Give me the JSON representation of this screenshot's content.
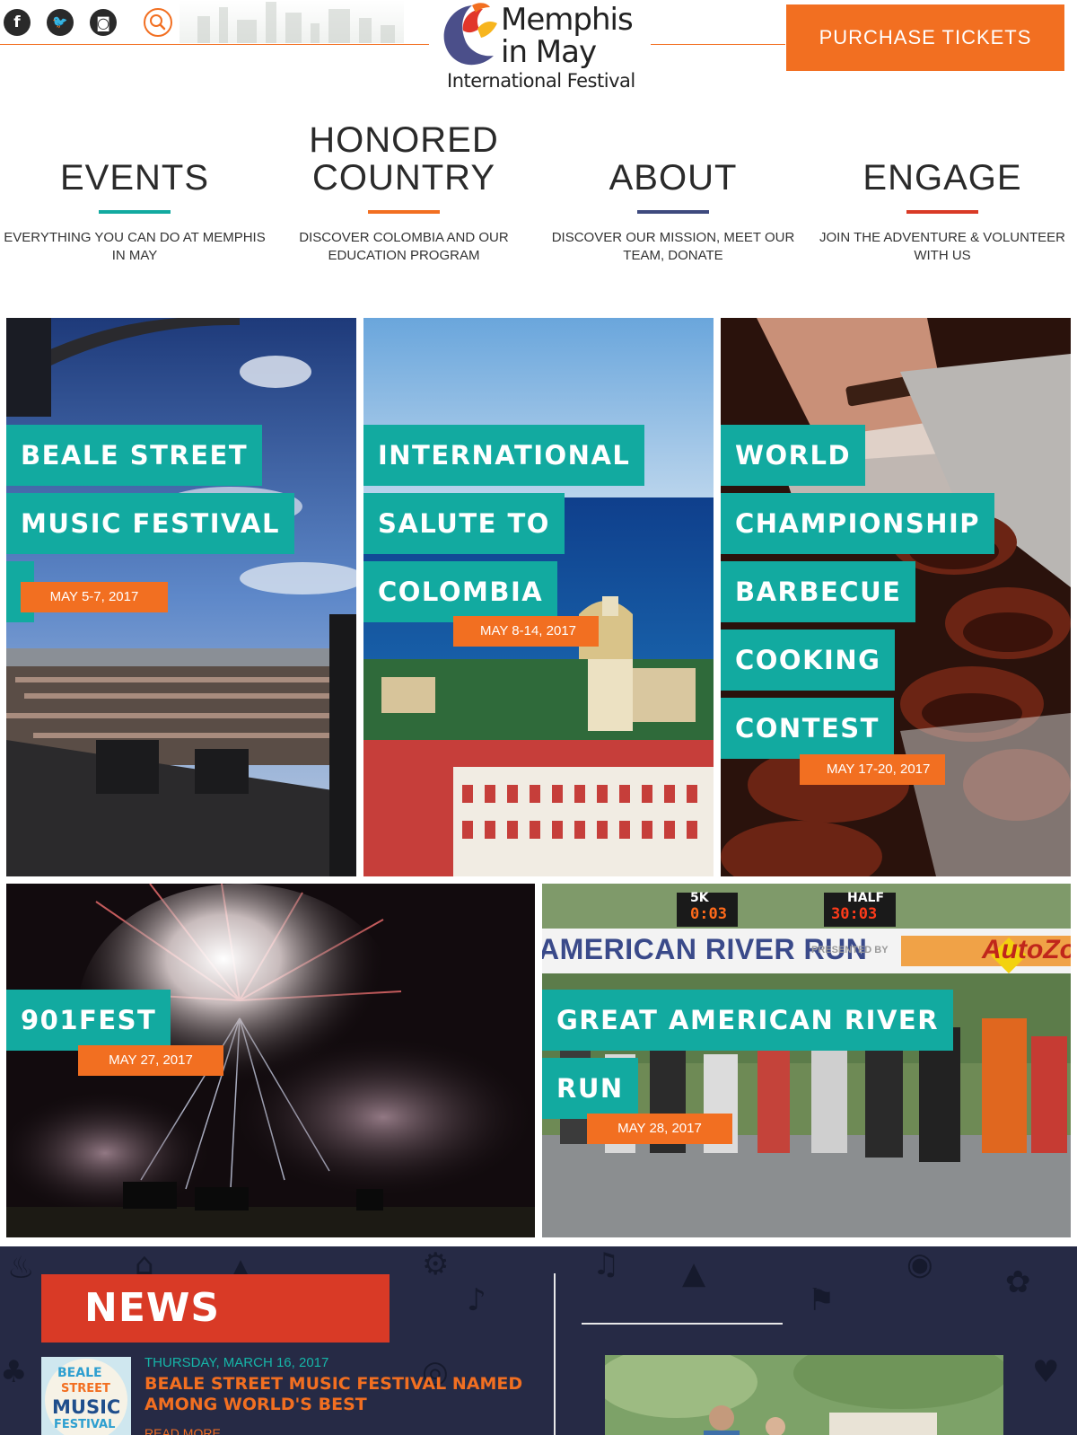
{
  "header": {
    "social": [
      {
        "name": "facebook-icon",
        "glyph": "f"
      },
      {
        "name": "twitter-icon",
        "glyph": "🐦"
      },
      {
        "name": "instagram-icon",
        "glyph": "◙"
      }
    ],
    "logo": {
      "line1": "Memphis",
      "line2": "in May",
      "line3": "International Festival"
    },
    "tickets_label": "PURCHASE TICKETS",
    "accent_color": "#f26f21"
  },
  "nav": [
    {
      "title_lines": [
        "EVENTS"
      ],
      "desc": "EVERYTHING YOU CAN DO AT MEMPHIS IN MAY",
      "underline_color": "#12aaa0"
    },
    {
      "title_lines": [
        "HONORED",
        "COUNTRY"
      ],
      "desc": "DISCOVER COLOMBIA AND OUR EDUCATION PROGRAM",
      "underline_color": "#f26f21"
    },
    {
      "title_lines": [
        "ABOUT"
      ],
      "desc": "DISCOVER OUR MISSION, MEET OUR TEAM, DONATE",
      "underline_color": "#3e4a7e"
    },
    {
      "title_lines": [
        "ENGAGE"
      ],
      "desc": "JOIN THE ADVENTURE & VOLUNTEER WITH US",
      "underline_color": "#d93a26"
    }
  ],
  "events": [
    {
      "tags": [
        "BEALE STREET",
        "MUSIC FESTIVAL"
      ],
      "date": "MAY 5-7, 2017"
    },
    {
      "tags": [
        "INTERNATIONAL",
        "SALUTE TO",
        "COLOMBIA"
      ],
      "date": "MAY 8-14, 2017"
    },
    {
      "tags": [
        "WORLD",
        "CHAMPIONSHIP",
        "BARBECUE",
        "COOKING",
        "CONTEST"
      ],
      "date": "MAY 17-20, 2017"
    },
    {
      "tags": [
        "901FEST"
      ],
      "date": "MAY 27, 2017"
    },
    {
      "tags": [
        "GREAT AMERICAN RIVER",
        "RUN"
      ],
      "date": "MAY 28, 2017"
    }
  ],
  "race_banner": {
    "clock1_label": "5K",
    "clock1_time": "0:03",
    "clock2_label": "HALF",
    "clock2_time": "30:03",
    "banner_text": "AMERICAN RIVER RUN",
    "presented_by": "PRESENTED BY",
    "sponsor": "AutoZo"
  },
  "news": {
    "heading": "NEWS",
    "item": {
      "date": "THURSDAY, MARCH 16, 2017",
      "title": "BEALE STREET MUSIC FESTIVAL NAMED AMONG WORLD'S BEST",
      "read_more": "READ MORE",
      "thumb_text": [
        "BEALE",
        "STREET",
        "MUSIC",
        "FESTIVAL"
      ]
    }
  },
  "colors": {
    "teal": "#12aaa0",
    "orange": "#f26f21",
    "navy": "#262a45",
    "red": "#d93a26"
  }
}
